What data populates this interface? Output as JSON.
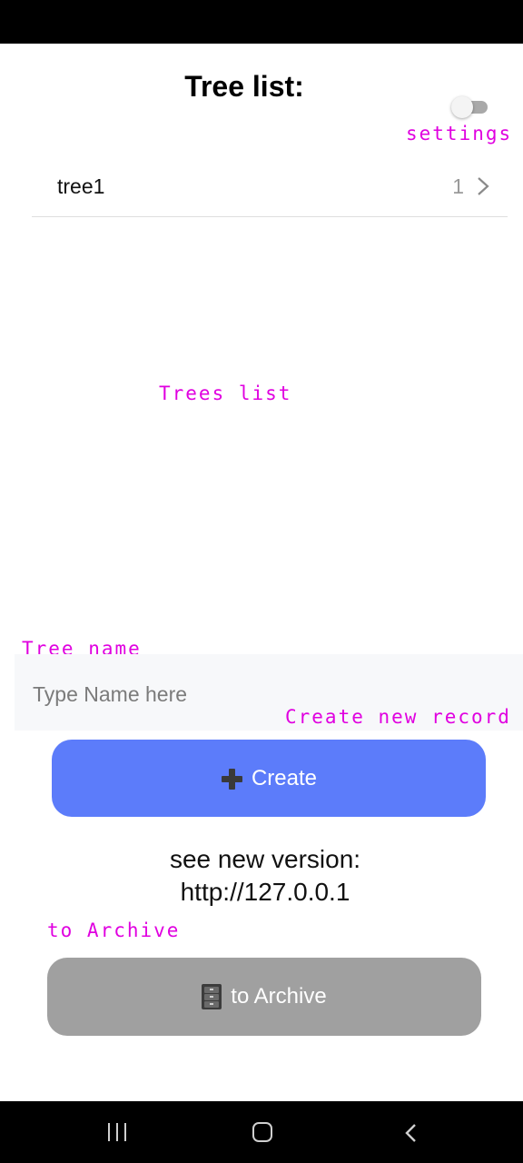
{
  "header": {
    "title": "Tree list:"
  },
  "settings_toggle": {
    "state": "off"
  },
  "tree_list": {
    "items": [
      {
        "name": "tree1",
        "count": "1"
      }
    ]
  },
  "annotations": {
    "settings": "settings",
    "trees_list": "Trees list",
    "tree_name": "Tree name",
    "create_new_record": "Create new record",
    "to_archive": "to Archive"
  },
  "form": {
    "name_placeholder": "Type Name here",
    "name_value": "",
    "create_label": "Create",
    "create_icon": "heavy-plus-icon"
  },
  "version_notice": {
    "line1": "see new version:",
    "line2": "http://127.0.0.1"
  },
  "archive_button": {
    "label": "to Archive",
    "icon": "file-cabinet-icon"
  },
  "navigation_bar": {
    "icons": [
      "recent-apps-icon",
      "home-icon",
      "back-icon"
    ]
  },
  "colors": {
    "create_button": "#5c7cfa",
    "archive_button": "#a0a0a0",
    "annotation": "#e000e0",
    "input_background": "#f7f8fa"
  }
}
